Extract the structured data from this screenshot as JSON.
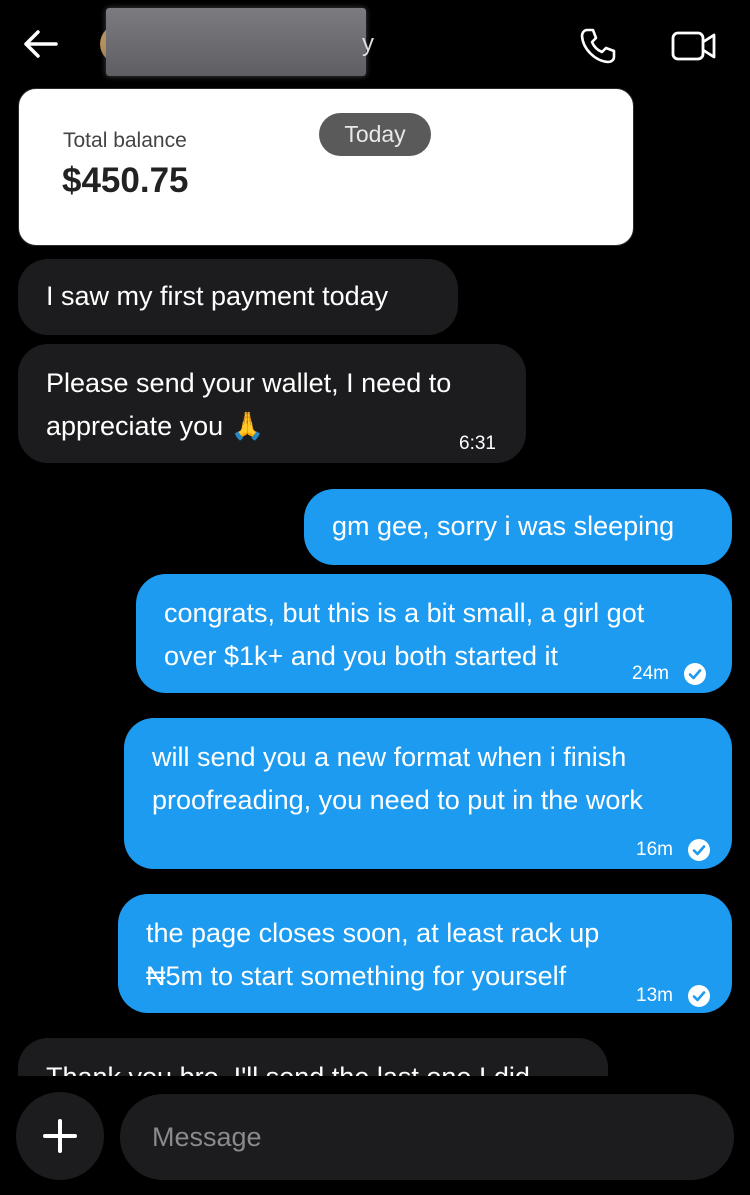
{
  "header": {
    "contact_name_tail": "y",
    "icons": {
      "back": "back-arrow-icon",
      "call": "phone-icon",
      "video": "video-camera-icon"
    }
  },
  "balance_card": {
    "label": "Total balance",
    "amount": "$450.75",
    "date_pill": "Today"
  },
  "messages": [
    {
      "direction": "in",
      "text": "I saw my first payment today",
      "time": ""
    },
    {
      "direction": "in",
      "text_line1": "Please send your wallet, I need to",
      "text_line2": "appreciate you 🙏",
      "time": "6:31"
    },
    {
      "direction": "out",
      "text": "gm gee, sorry i was sleeping",
      "time": ""
    },
    {
      "direction": "out",
      "text_line1": "congrats, but this is a bit small, a girl got",
      "text_line2": "over $1k+ and you both started it",
      "time": "24m",
      "read": true
    },
    {
      "direction": "out",
      "text_line1": "will send you a new format when i finish",
      "text_line2": "proofreading, you need to put in the work",
      "time": "16m",
      "read": true
    },
    {
      "direction": "out",
      "text_line1": "the page closes soon, at least rack up",
      "text_line2": "₦5m to start something for yourself",
      "time": "13m",
      "read": true
    },
    {
      "direction": "in",
      "text": "Thank you bro, I'll send the last one I did",
      "time": ""
    }
  ],
  "composer": {
    "placeholder": "Message",
    "add_icon": "plus-icon"
  },
  "colors": {
    "outgoing": "#1d9bf0",
    "incoming": "#1c1c1e",
    "background": "#000000"
  }
}
